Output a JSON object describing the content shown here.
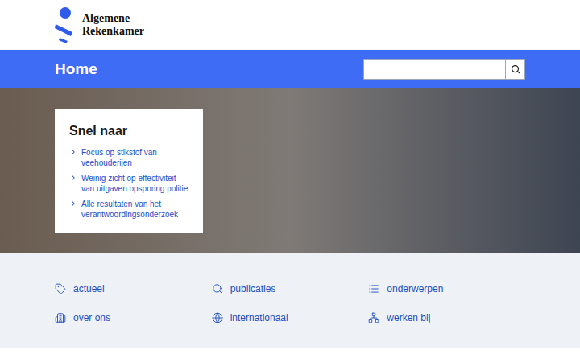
{
  "logo": {
    "line1": "Algemene",
    "line2": "Rekenkamer"
  },
  "page_title": "Home",
  "quick_links": {
    "title": "Snel naar",
    "items": [
      {
        "label": "Focus op stikstof van veehouderijen"
      },
      {
        "label": "Weinig zicht op effectiviteit van uitgaven opsporing politie"
      },
      {
        "label": "Alle resultaten van het verantwoordingsonderzoek"
      }
    ]
  },
  "nav": [
    {
      "label": "actueel"
    },
    {
      "label": "publicaties"
    },
    {
      "label": "onderwerpen"
    },
    {
      "label": "over ons"
    },
    {
      "label": "internationaal"
    },
    {
      "label": "werken bij"
    }
  ]
}
